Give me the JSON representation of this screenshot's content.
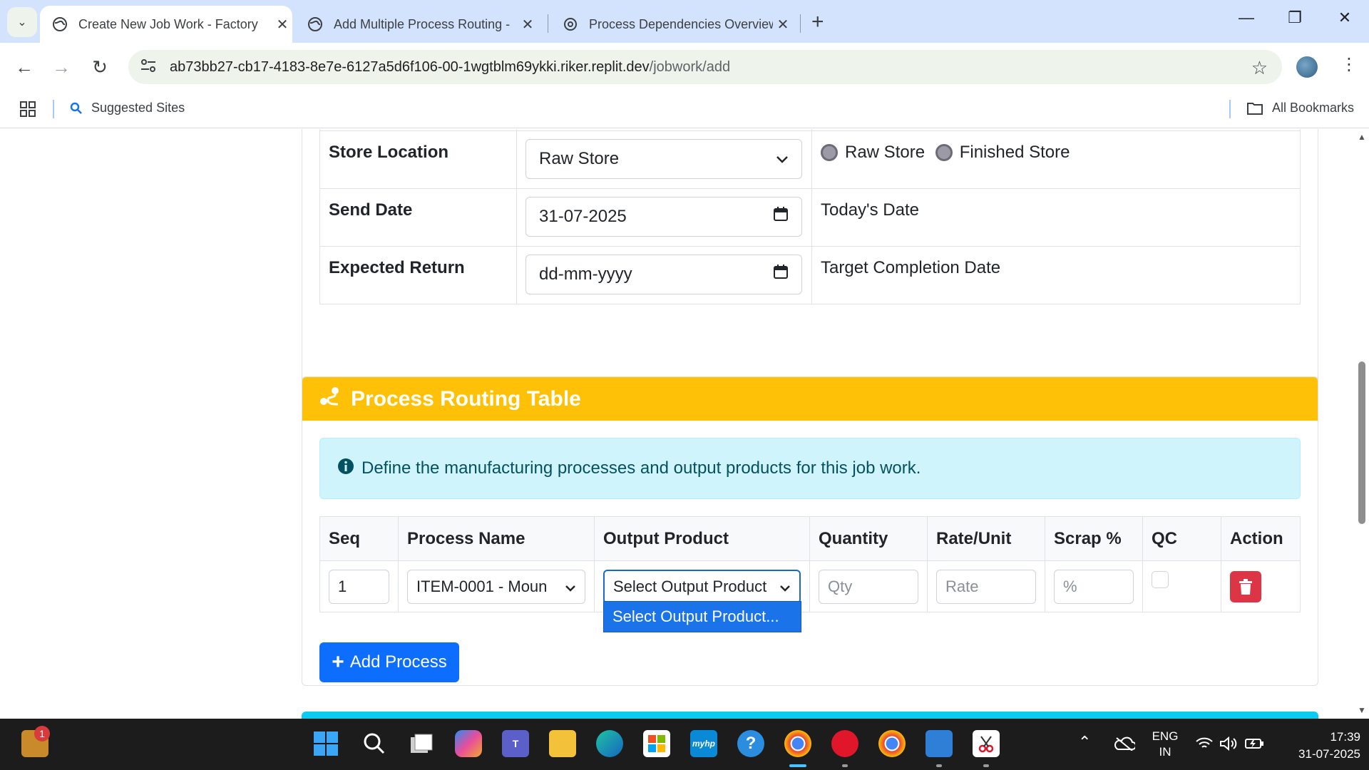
{
  "browser": {
    "tabs": [
      {
        "title": "Create New Job Work - Factory",
        "active": true
      },
      {
        "title": "Add Multiple Process Routing -",
        "active": false
      },
      {
        "title": "Process Dependencies Overview",
        "active": false
      }
    ],
    "url_host": "ab73bb27-cb17-4183-8e7e-6127a5d6f106-00-1wgtblm69ykki.riker.replit.dev",
    "url_path": "/jobwork/add",
    "bookmarks": {
      "suggested": "Suggested Sites",
      "all": "All Bookmarks"
    }
  },
  "form": {
    "rows": [
      {
        "label": "Store Location",
        "value": "Raw Store",
        "control": "select",
        "radios": [
          "Raw Store",
          "Finished Store"
        ]
      },
      {
        "label": "Send Date",
        "value": "31-07-2025",
        "control": "date",
        "info": "Today's Date"
      },
      {
        "label": "Expected Return",
        "value": "dd-mm-yyyy",
        "control": "date",
        "info": "Target Completion Date"
      }
    ]
  },
  "routing": {
    "title": "Process Routing Table",
    "alert": "Define the manufacturing processes and output products for this job work.",
    "headers": [
      "Seq",
      "Process Name",
      "Output Product",
      "Quantity",
      "Rate/Unit",
      "Scrap %",
      "QC",
      "Action"
    ],
    "row": {
      "seq": "1",
      "process": "ITEM-0001 - Moun",
      "output_product": "Select Output Product",
      "qty_placeholder": "Qty",
      "rate_placeholder": "Rate",
      "scrap_placeholder": "%"
    },
    "dropdown_option": "Select Output Product...",
    "add_button": "Add Process"
  },
  "taskbar": {
    "notification_count": "1",
    "lang": "ENG",
    "region": "IN",
    "time": "17:39",
    "date": "31-07-2025"
  },
  "colors": {
    "tabstrip": "#d3e3fd",
    "routing_header": "#ffc107",
    "primary": "#0d6efd",
    "danger": "#dc3545",
    "alert_bg": "#cff4fc",
    "alert_text": "#055160"
  }
}
